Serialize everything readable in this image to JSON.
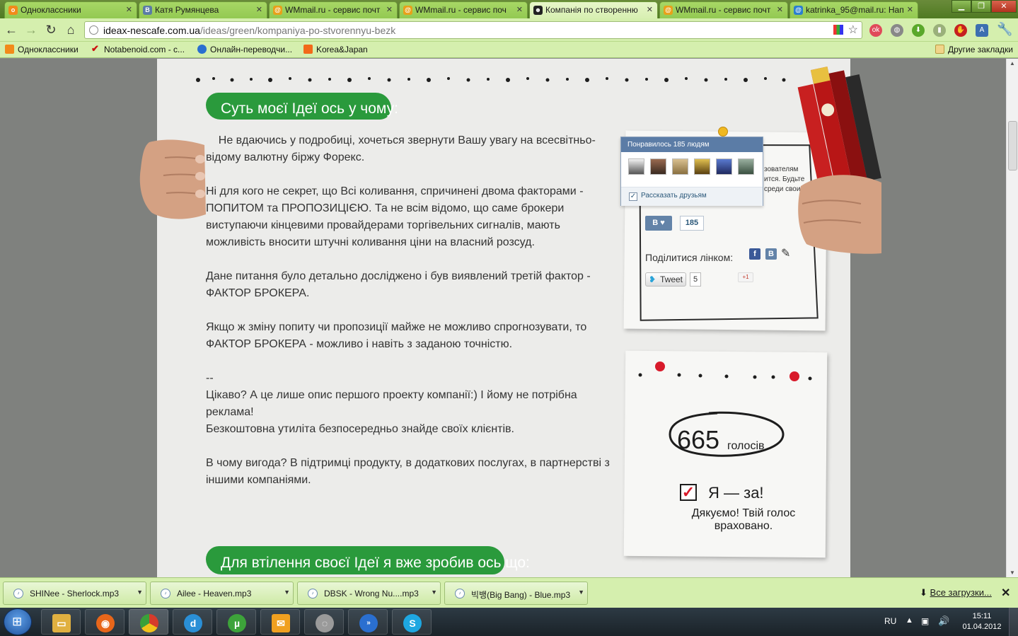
{
  "browser": {
    "tabs": [
      {
        "label": "Одноклассники",
        "icon": "odnoklassniki-icon",
        "color": "#f28b1a",
        "glyph": "о"
      },
      {
        "label": "Катя Румянцева",
        "icon": "vk-icon",
        "color": "#5b7ca6",
        "glyph": "В"
      },
      {
        "label": "WMmail.ru - сервис почт",
        "icon": "wmmail-icon",
        "color": "#e8a019",
        "glyph": "@"
      },
      {
        "label": "WMmail.ru - сервис поч",
        "icon": "wmmail-icon",
        "color": "#e8a019",
        "glyph": "@"
      },
      {
        "label": "Компанія по створенню",
        "icon": "nescafe-icon",
        "color": "#222222",
        "glyph": "☻"
      },
      {
        "label": "WMmail.ru - сервис почт",
        "icon": "wmmail-icon",
        "color": "#e8a019",
        "glyph": "@"
      },
      {
        "label": "katrinka_95@mail.ru: Нап",
        "icon": "mailru-icon",
        "color": "#2a7fd0",
        "glyph": "@"
      }
    ],
    "active_tab": 4,
    "url_host": "ideax-nescafe.com.ua",
    "url_path": "/ideas/green/kompaniya-po-stvorennyu-bezk",
    "bookmarks": [
      {
        "label": "Одноклассники",
        "color": "#f28b1a"
      },
      {
        "label": "Notabenoid.com - с...",
        "color": "#cc1111"
      },
      {
        "label": "Онлайн-переводчи...",
        "color": "#2a6fd0"
      },
      {
        "label": "Korea&Japan",
        "color": "#f26a1a"
      }
    ],
    "other_bookmarks": "Другие закладки"
  },
  "article": {
    "heading1": "Суть моєї Ідеї ось у чому:",
    "paragraphs": [
      "    Не вдаючись у подробиці, хочеться звернути Вашу увагу на всесвітньо-відому валютну біржу Форекс.",
      "Ні для кого не секрет, що Всі коливання, спричинені двома факторами - ПОПИТОМ та ПРОПОЗИЦІЄЮ. Та не всім відомо, що саме брокери виступаючи кінцевими провайдерами торгівельних сигналів, мають можливість вносити штучні коливання ціни на власний розсуд.",
      "Дане питання було детально досліджено і був виявлений третій фактор - ФАКТОР БРОКЕРА.",
      "Якщо ж зміну попиту чи пропозиції майже не можливо спрогнозувати, то ФАКТОР БРОКЕРА - можливо і навіть з заданою точністю."
    ],
    "closing_lines": [
      "--",
      "Цікаво? А це лише опис першого проекту компанії:) І йому не потрібна реклама!",
      "Безкоштовна утиліта безпосередньо знайде своїх клієнтів."
    ],
    "last_paragraph": "В чому вигода? В підтримці продукту, в додаткових послугах, в партнерстві з іншими компаніями.",
    "heading2": "Для втілення своєї Ідеї я вже зробив ось що:"
  },
  "social": {
    "popup_header": "Понравилось 185 людям",
    "popup_share": "Рассказать друзьям",
    "behind_text": [
      "зователям",
      "ится. Будьте",
      "среди своих"
    ],
    "like_count": "185",
    "vk_label": "В",
    "share_label": "Поділитися лінком:",
    "tweet_label": "Tweet",
    "tweet_count": "5",
    "gplus_label": "+1"
  },
  "votes": {
    "count": "665",
    "unit": "голосів",
    "vote_label": "Я — за!",
    "thanks": "Дякуємо! Твій голос враховано."
  },
  "downloads": {
    "items": [
      "SHINee - Sherlock.mp3",
      "Ailee - Heaven.mp3",
      "DBSK - Wrong Nu....mp3",
      "빅뱅(Big Bang) - Blue.mp3"
    ],
    "all_label": "Все загрузки..."
  },
  "taskbar": {
    "apps": [
      {
        "icon": "explorer-icon",
        "color": "#e0b040"
      },
      {
        "icon": "firefox-icon",
        "color": "#e8661a"
      },
      {
        "icon": "chrome-icon",
        "color": "#d63b2b"
      },
      {
        "icon": "dictionary-icon",
        "color": "#2a8fd6"
      },
      {
        "icon": "utorrent-icon",
        "color": "#3da33a"
      },
      {
        "icon": "mail-agent-icon",
        "color": "#f0a020"
      },
      {
        "icon": "media-icon",
        "color": "#9a9a9a"
      },
      {
        "icon": "rss-icon",
        "color": "#2a6fd0"
      },
      {
        "icon": "skype-icon",
        "color": "#1ea7e1"
      }
    ],
    "lang": "RU",
    "time": "15:11",
    "date": "01.04.2012"
  }
}
